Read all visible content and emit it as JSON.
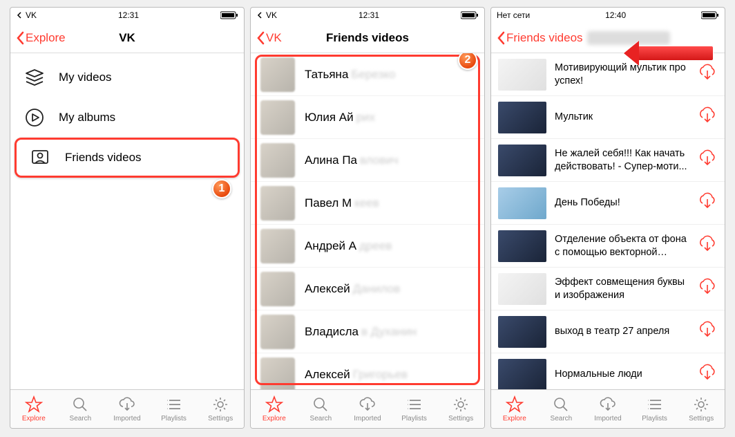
{
  "screen1": {
    "status": {
      "left": "VK",
      "time": "12:31"
    },
    "back": "Explore",
    "title": "VK",
    "menu": [
      {
        "label": "My videos"
      },
      {
        "label": "My albums"
      },
      {
        "label": "Friends videos"
      }
    ],
    "badge": "1"
  },
  "screen2": {
    "status": {
      "left": "VK",
      "time": "12:31"
    },
    "back": "VK",
    "title": "Friends videos",
    "friends": [
      {
        "name": "Татьяна",
        "suffix": "Березко"
      },
      {
        "name": "Юлия Ай",
        "suffix": "рих"
      },
      {
        "name": "Алина Па",
        "suffix": "влович"
      },
      {
        "name": "Павел М",
        "suffix": "кеев"
      },
      {
        "name": "Андрей А",
        "suffix": "дреев"
      },
      {
        "name": "Алексей",
        "suffix": "Данилов"
      },
      {
        "name": "Владисла",
        "suffix": "в Духанин"
      },
      {
        "name": "Алексей",
        "suffix": "Григорьев"
      }
    ],
    "badge": "2"
  },
  "screen3": {
    "status": {
      "left": "Нет сети",
      "time": "12:40"
    },
    "back": "Friends videos",
    "videos": [
      {
        "title": "Мотивирующий мультик про успех!",
        "thumb": "white"
      },
      {
        "title": "Мультик",
        "thumb": "dark"
      },
      {
        "title": "Не жалей себя!!! Как начать действовать! - Супер-моти...",
        "thumb": "dark"
      },
      {
        "title": "День Победы!",
        "thumb": "light"
      },
      {
        "title": "Отделение объекта от фона с помощью векторной маск...",
        "thumb": "dark"
      },
      {
        "title": "Эффект совмещения буквы и изображения",
        "thumb": "white"
      },
      {
        "title": "выход в театр 27 апреля",
        "thumb": "dark"
      },
      {
        "title": "Нормальные люди",
        "thumb": "dark"
      }
    ]
  },
  "tabs": [
    {
      "label": "Explore"
    },
    {
      "label": "Search"
    },
    {
      "label": "Imported"
    },
    {
      "label": "Playlists"
    },
    {
      "label": "Settings"
    }
  ]
}
